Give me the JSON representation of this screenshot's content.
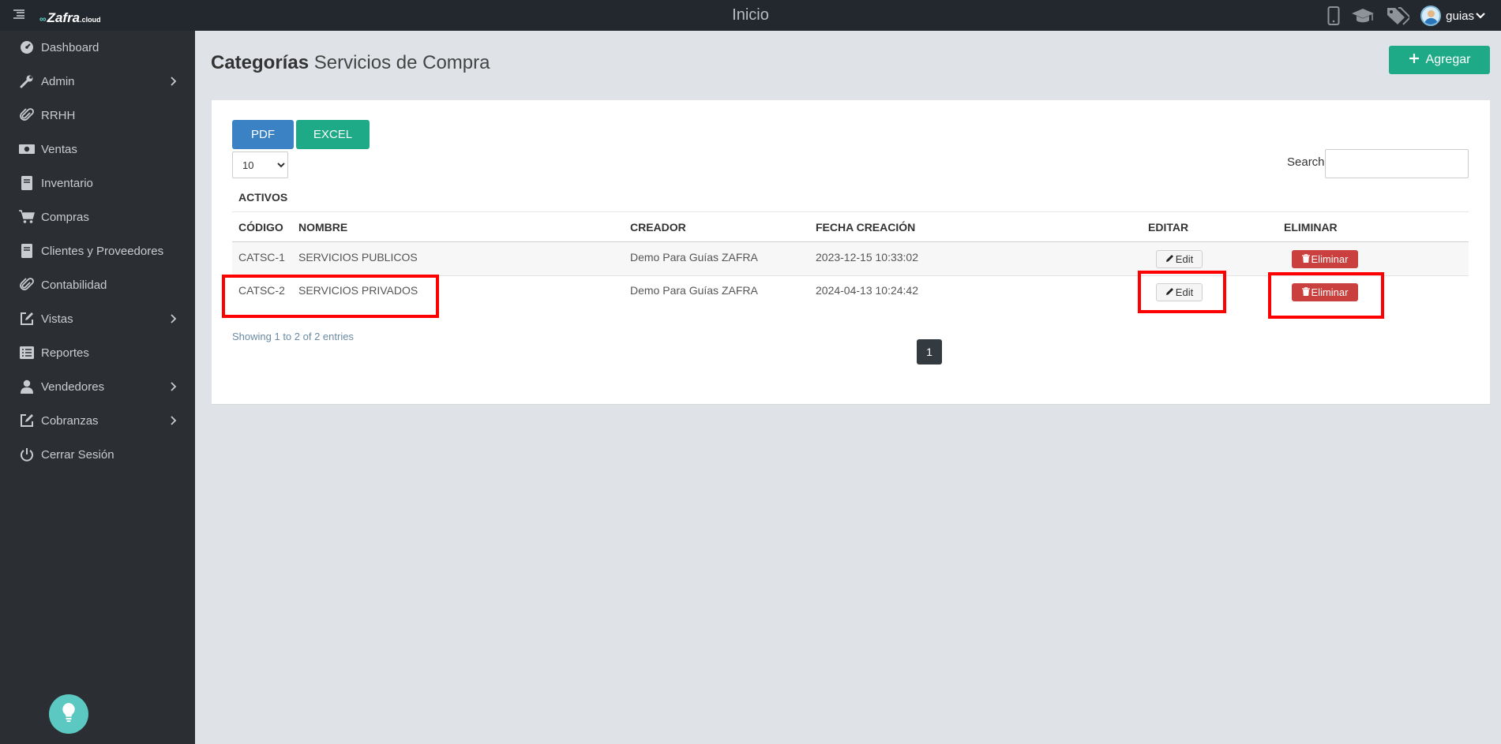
{
  "app": {
    "brand_main": "Zafra",
    "brand_sub": ".cloud",
    "top_title": "Inicio",
    "user_name": "guias"
  },
  "sidebar": {
    "items": [
      {
        "label": "Dashboard",
        "icon": "dashboard-icon",
        "has_submenu": false
      },
      {
        "label": "Admin",
        "icon": "wrench-icon",
        "has_submenu": true
      },
      {
        "label": "RRHH",
        "icon": "paperclip-icon",
        "has_submenu": false
      },
      {
        "label": "Ventas",
        "icon": "money-icon",
        "has_submenu": false
      },
      {
        "label": "Inventario",
        "icon": "book-icon",
        "has_submenu": false
      },
      {
        "label": "Compras",
        "icon": "cart-icon",
        "has_submenu": false
      },
      {
        "label": "Clientes y Proveedores",
        "icon": "book-icon",
        "has_submenu": false
      },
      {
        "label": "Contabilidad",
        "icon": "paperclip-icon",
        "has_submenu": false
      },
      {
        "label": "Vistas",
        "icon": "edit-icon",
        "has_submenu": true
      },
      {
        "label": "Reportes",
        "icon": "list-icon",
        "has_submenu": false
      },
      {
        "label": "Vendedores",
        "icon": "user-icon",
        "has_submenu": true
      },
      {
        "label": "Cobranzas",
        "icon": "edit-icon",
        "has_submenu": true
      },
      {
        "label": "Cerrar Sesión",
        "icon": "power-icon",
        "has_submenu": false
      }
    ]
  },
  "page": {
    "title_strong": "Categorías",
    "title_sub": "Servicios de Compra",
    "add_label": "Agregar"
  },
  "toolbar": {
    "pdf_label": "PDF",
    "excel_label": "EXCEL",
    "page_length": "10",
    "search_label": "Search:",
    "search_value": ""
  },
  "table": {
    "group_label": "ACTIVOS",
    "headers": {
      "codigo": "CÓDIGO",
      "nombre": "NOMBRE",
      "creador": "CREADOR",
      "fecha": "FECHA CREACIÓN",
      "editar": "EDITAR",
      "eliminar": "ELIMINAR"
    },
    "rows": [
      {
        "codigo": "CATSC-1",
        "nombre": "SERVICIOS PUBLICOS",
        "creador": "Demo Para Guías ZAFRA",
        "fecha": "2023-12-15 10:33:02",
        "edit_label": "Edit",
        "delete_label": "Eliminar"
      },
      {
        "codigo": "CATSC-2",
        "nombre": "SERVICIOS PRIVADOS",
        "creador": "Demo Para Guías ZAFRA",
        "fecha": "2024-04-13 10:24:42",
        "edit_label": "Edit",
        "delete_label": "Eliminar"
      }
    ],
    "info": "Showing 1 to 2 of 2 entries",
    "current_page": "1"
  },
  "colors": {
    "sidebar": "#2b2f33",
    "topbar": "#23282e",
    "primary_green": "#1eaa86",
    "pdf_blue": "#3a82c4",
    "danger": "#c9403e",
    "highlight": "#ff0000"
  }
}
